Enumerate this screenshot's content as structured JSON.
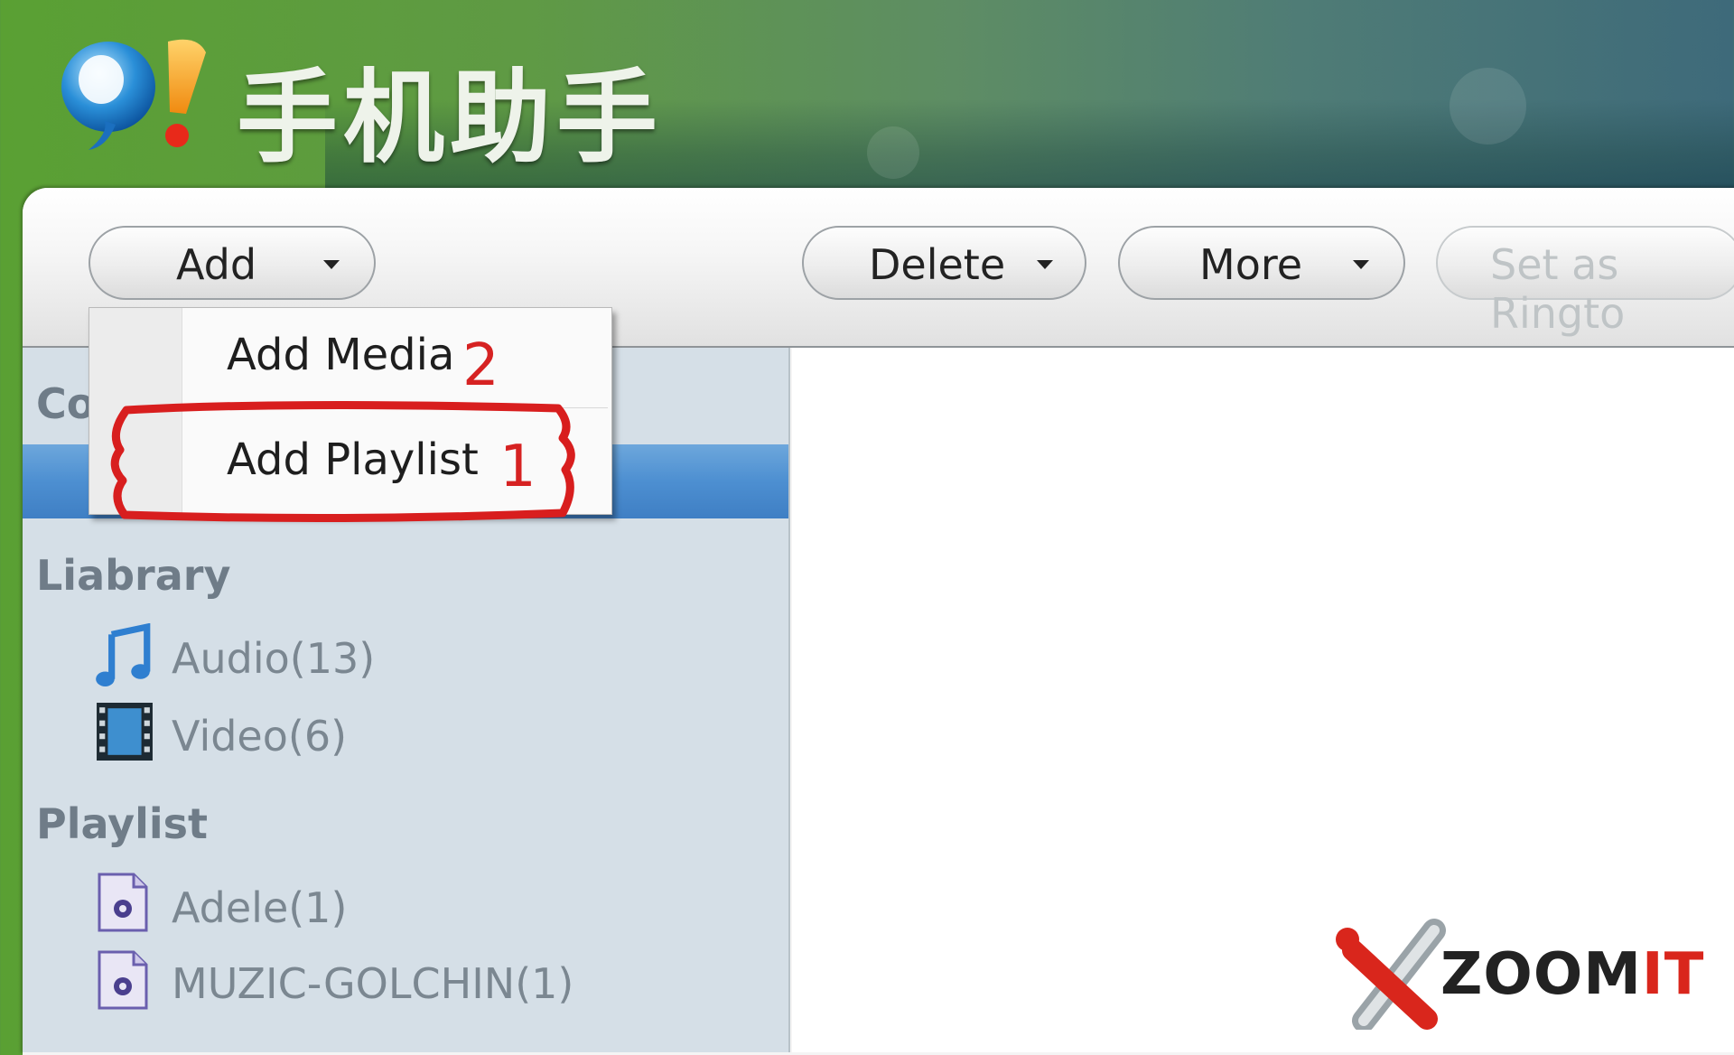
{
  "app": {
    "title": "手机助手"
  },
  "toolbar": {
    "add_label": "Add",
    "delete_label": "Delete",
    "more_label": "More",
    "ringtone_label": "Set as Ringto"
  },
  "add_menu": {
    "items": [
      {
        "label": "Add Media",
        "annotation": "2"
      },
      {
        "label": "Add Playlist",
        "annotation": "1"
      }
    ]
  },
  "sidebar": {
    "partial_section": "Co",
    "library_heading": "Liabrary",
    "library_items": [
      {
        "label": "Audio(13)",
        "icon": "music-note-icon"
      },
      {
        "label": "Video(6)",
        "icon": "film-icon"
      }
    ],
    "playlist_heading": "Playlist",
    "playlist_items": [
      {
        "label": "Adele(1)",
        "icon": "playlist-file-icon"
      },
      {
        "label": "MUZIC-GOLCHIN(1)",
        "icon": "playlist-file-icon"
      }
    ]
  },
  "watermark": {
    "text_main": "ZOOM",
    "text_accent": "IT"
  },
  "colors": {
    "selection": "#4d8fd1",
    "annotation": "#d62222",
    "sidebar_bg": "#d5dfe7"
  }
}
